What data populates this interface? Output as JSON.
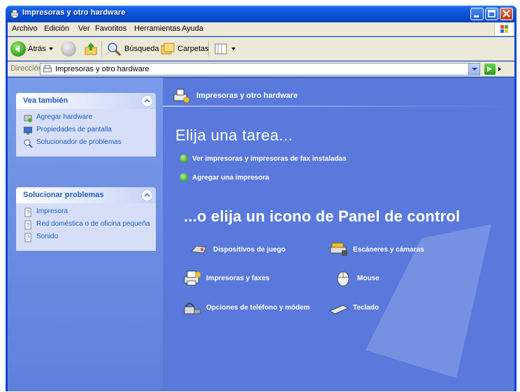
{
  "window": {
    "title": "Impresoras y otro hardware"
  },
  "menubar": {
    "items": [
      "Archivo",
      "Edición",
      "Ver",
      "Favoritos",
      "Herramientas",
      "Ayuda"
    ]
  },
  "toolbar": {
    "back_label": "Atrás",
    "search_label": "Búsqueda",
    "folders_label": "Carpetas"
  },
  "address": {
    "label": "Dirección",
    "value": "Impresoras y otro hardware"
  },
  "sidebar": {
    "see_also": {
      "title": "Vea también",
      "items": [
        "Agregar hardware",
        "Propiedades de pantalla",
        "Solucionador de problemas"
      ]
    },
    "troubleshooters": {
      "title": "Solucionar problemas",
      "items": [
        "Impresora",
        "Red doméstica o de oficina pequeña",
        "Sonido"
      ]
    }
  },
  "main": {
    "header": "Impresoras y otro hardware",
    "pick_task": "Elija una tarea...",
    "tasks": [
      "Ver impresoras y impresoras de fax instaladas",
      "Agregar una impresora"
    ],
    "pick_icon": "...o elija un icono de Panel de control",
    "icons": [
      {
        "label": "Dispositivos de juego",
        "icon": "gamepad-icon"
      },
      {
        "label": "Escáneres y cámaras",
        "icon": "scanner-icon"
      },
      {
        "label": "Impresoras y faxes",
        "icon": "printer-icon"
      },
      {
        "label": "Mouse",
        "icon": "mouse-icon"
      },
      {
        "label": "Opciones de teléfono y módem",
        "icon": "phone-modem-icon"
      },
      {
        "label": "Teclado",
        "icon": "keyboard-icon"
      }
    ]
  },
  "colors": {
    "titlebar": "#0a53d8",
    "content_bg": "#5979dc",
    "sidebar_box": "#d6dff7",
    "link_blue": "#215dc6"
  }
}
